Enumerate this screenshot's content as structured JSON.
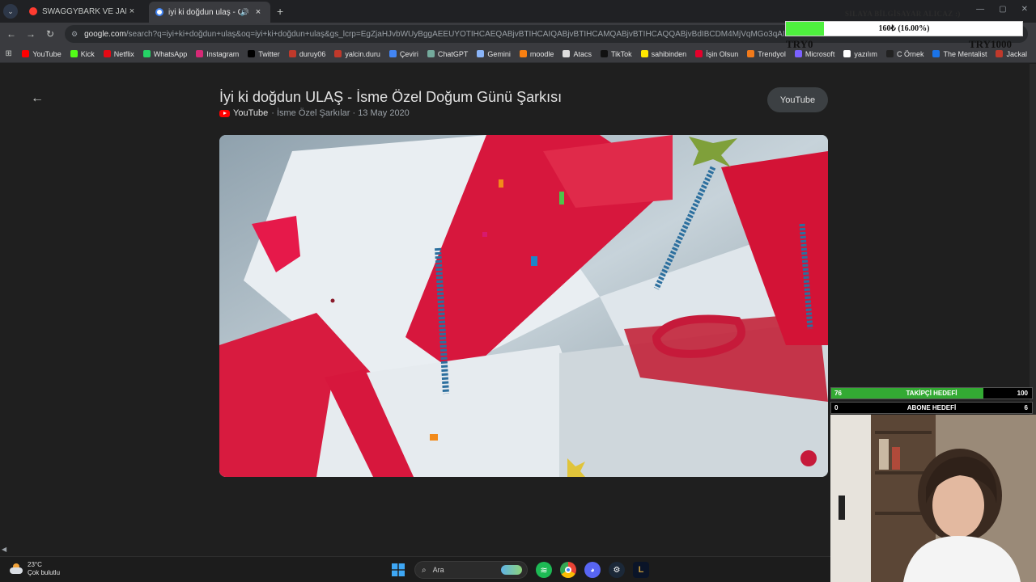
{
  "tabs": [
    {
      "title": "SWAGGYBARK VE JAHREIN BE",
      "favicon_color": "#ff3b30",
      "active": false
    },
    {
      "title": "iyi ki doğdun ulaş - Google",
      "favicon_color": "#ffffff",
      "active": true,
      "audio": true
    }
  ],
  "tab_icons": {
    "menu": "chevron-down-icon",
    "close": "×",
    "new": "+",
    "audio": "🔊"
  },
  "address": {
    "host": "google.com",
    "path": "/search?q=iyi+ki+doğdun+ulaş&oq=iyi+ki+doğdun+ulaş&gs_lcrp=EgZjaHJvbWUyBggAEEUYOTIHCAEQABjvBTIHCAIQABjvBTIHCAMQABjvBTIHCAQQABjvBdIBCDM4MjVqMGo3qAIAsAIA&sourceid=c"
  },
  "bookmarks": [
    {
      "label": "YouTube",
      "color": "#ff0000"
    },
    {
      "label": "Kick",
      "color": "#53fc18"
    },
    {
      "label": "Netflix",
      "color": "#e50914"
    },
    {
      "label": "WhatsApp",
      "color": "#25d366"
    },
    {
      "label": "Instagram",
      "color": "#d62976"
    },
    {
      "label": "Twitter",
      "color": "#000000"
    },
    {
      "label": "duruy06",
      "color": "#c0392b"
    },
    {
      "label": "yalcin.duru",
      "color": "#c0392b"
    },
    {
      "label": "Çeviri",
      "color": "#4285f4"
    },
    {
      "label": "ChatGPT",
      "color": "#74aa9c"
    },
    {
      "label": "Gemini",
      "color": "#8ab4f8"
    },
    {
      "label": "moodle",
      "color": "#f98012"
    },
    {
      "label": "Atacs",
      "color": "#dddddd"
    },
    {
      "label": "TikTok",
      "color": "#111111"
    },
    {
      "label": "sahibinden",
      "color": "#ffe800"
    },
    {
      "label": "İşin Olsun",
      "color": "#e4002b"
    },
    {
      "label": "Trendyol",
      "color": "#f27a1a"
    },
    {
      "label": "Microsoft",
      "color": "#7b61ff"
    },
    {
      "label": "yazılım",
      "color": "#ffffff"
    },
    {
      "label": "C Örnek",
      "color": "#222222"
    },
    {
      "label": "The Mentalist",
      "color": "#1a73e8"
    },
    {
      "label": "Jackal",
      "color": "#c0392b"
    }
  ],
  "video": {
    "title": "İyi ki doğdun ULAŞ - İsme Özel Doğum Günü Şarkısı",
    "source": "YouTube",
    "channel": "· İsme Özel Şarkılar · 13 May 2020",
    "open_button": "YouTube"
  },
  "donation_goal": {
    "title": "SILAYA BİLGİSAYAR ALICAZ :)",
    "progress_label": "160₺ (16.00%)",
    "progress": 0.16,
    "min_label": "TRY0",
    "max_label": "TRY1000",
    "fill_color": "#4ef03e"
  },
  "goals": [
    {
      "name": "TAKİPÇİ HEDEFİ",
      "current": "76",
      "target": "100",
      "progress": 0.76
    },
    {
      "name": "ABONE HEDEFİ",
      "current": "0",
      "target": "6",
      "progress": 0
    }
  ],
  "weather": {
    "temp": "23°C",
    "desc": "Çok bulutlu"
  },
  "taskbar": {
    "search_label": "Ara"
  }
}
